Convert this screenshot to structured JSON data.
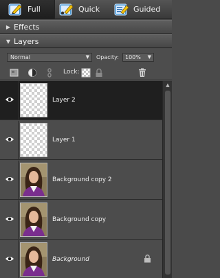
{
  "modes": [
    {
      "label": "Full",
      "icon": "full-edit-icon",
      "active": true
    },
    {
      "label": "Quick",
      "icon": "quick-edit-icon",
      "active": false
    },
    {
      "label": "Guided",
      "icon": "guided-edit-icon",
      "active": false
    }
  ],
  "panels": {
    "effects": {
      "title": "Effects",
      "state": "collapsed"
    },
    "layers": {
      "title": "Layers",
      "state": "expanded"
    }
  },
  "layer_options": {
    "blend_mode": "Normal",
    "opacity_label": "Opacity:",
    "opacity_value": "100%"
  },
  "toolbar": {
    "lock_label": "Lock:",
    "icons": [
      "new-layer-icon",
      "adjustment-layer-icon",
      "link-icon",
      "lock-transparent-icon",
      "lock-all-icon",
      "delete-layer-icon"
    ]
  },
  "layers": [
    {
      "name": "Layer 2",
      "selected": true,
      "visible": true,
      "thumbnail": "transparent",
      "locked": false,
      "italic": false
    },
    {
      "name": "Layer 1",
      "selected": false,
      "visible": true,
      "thumbnail": "transparent",
      "locked": false,
      "italic": false
    },
    {
      "name": "Background copy 2",
      "selected": false,
      "visible": true,
      "thumbnail": "portrait",
      "locked": false,
      "italic": false
    },
    {
      "name": "Background copy",
      "selected": false,
      "visible": true,
      "thumbnail": "portrait",
      "locked": false,
      "italic": false
    },
    {
      "name": "Background",
      "selected": false,
      "visible": true,
      "thumbnail": "portrait",
      "locked": true,
      "italic": true
    }
  ],
  "colors": {
    "panel_bg": "#4a4a4a",
    "selected_row": "#1f1f1f",
    "mode_active": "#1e1e1e"
  }
}
